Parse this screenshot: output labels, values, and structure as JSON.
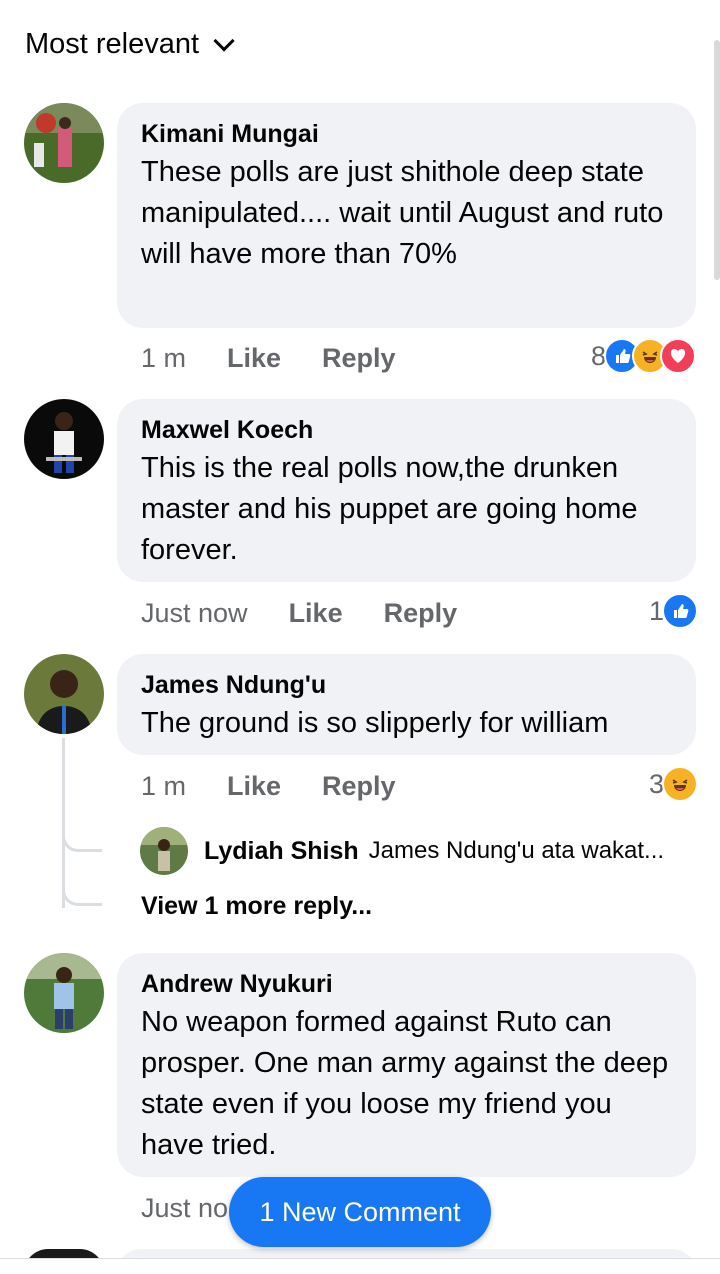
{
  "sort": {
    "label": "Most relevant"
  },
  "comments": [
    {
      "author": "Kimani Mungai",
      "text": "These polls are just shithole deep state manipulated.... wait until August and ruto will have more than 70%",
      "time": "1 m",
      "like_label": "Like",
      "reply_label": "Reply",
      "reaction_count": "8",
      "reactions": [
        "like-icon",
        "haha-icon",
        "love-icon"
      ]
    },
    {
      "author": "Maxwel Koech",
      "text": "This is the real polls now,the drunken master and his puppet are going home forever.",
      "time": "Just now",
      "like_label": "Like",
      "reply_label": "Reply",
      "reaction_count": "1",
      "reactions": [
        "like-icon"
      ]
    },
    {
      "author": "James Ndung'u",
      "text": "The ground is so slipperly for william",
      "time": "1 m",
      "like_label": "Like",
      "reply_label": "Reply",
      "reaction_count": "3",
      "reactions": [
        "haha-icon"
      ],
      "reply_preview": {
        "author": "Lydiah Shish",
        "snippet": "James Ndung'u  ata wakat..."
      },
      "more_replies": "View 1 more reply..."
    },
    {
      "author": "Andrew Nyukuri",
      "text": "No weapon formed against Ruto can prosper. One man army against the deep state even if you loose my friend you have tried.",
      "time": "Just no"
    }
  ],
  "new_comment_button": "1 New Comment",
  "colors": {
    "accent": "#1877f2",
    "bubble": "#f0f2f5",
    "meta": "#65676b",
    "love": "#f33e58",
    "haha": "#f7b125"
  }
}
